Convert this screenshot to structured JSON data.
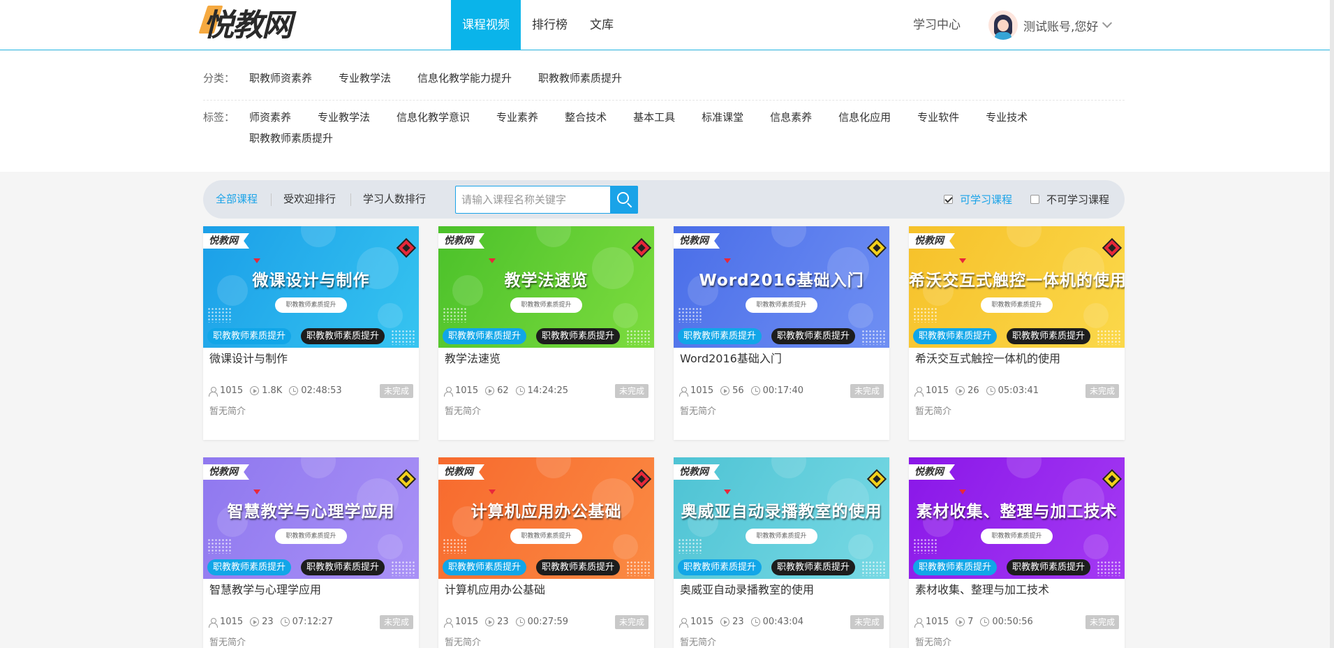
{
  "header": {
    "logo": "悦教网",
    "nav": [
      {
        "label": "课程视频",
        "active": true
      },
      {
        "label": "排行榜",
        "active": false
      },
      {
        "label": "文库",
        "active": false
      }
    ],
    "study_center": "学习中心",
    "user_name": "测试账号,您好"
  },
  "filters": {
    "category_label": "分类：",
    "categories": [
      "职教师资素养",
      "专业教学法",
      "信息化教学能力提升",
      "职教教师素质提升"
    ],
    "tag_label": "标签：",
    "tags": [
      "师资素养",
      "专业教学法",
      "信息化教学意识",
      "专业素养",
      "整合技术",
      "基本工具",
      "标准课堂",
      "信息素养",
      "信息化应用",
      "专业软件",
      "专业技术",
      "职教教师素质提升"
    ]
  },
  "toolbar": {
    "sort_all": "全部课程",
    "sort_popular": "受欢迎排行",
    "sort_learners": "学习人数排行",
    "search_placeholder": "请输入课程名称关键字",
    "filter_available": "可学习课程",
    "filter_unavailable": "不可学习课程"
  },
  "card_common": {
    "thumb_logo": "悦教网",
    "thumb_pill": "职教教师素质提升",
    "tag1": "职教教师素质提升",
    "tag2": "职教教师素质提升",
    "status": "未完成",
    "desc": "暂无简介"
  },
  "courses": [
    {
      "title": "微课设计与制作",
      "learners": "1015",
      "plays": "1.8K",
      "duration": "02:48:53",
      "color1": "#1b9fe8",
      "color2": "#36c4f0",
      "diamond": "#e8283a"
    },
    {
      "title": "教学法速览",
      "learners": "1015",
      "plays": "62",
      "duration": "14:24:25",
      "color1": "#4bc12a",
      "color2": "#7ddc3f",
      "diamond": "#e8283a"
    },
    {
      "title": "Word2016基础入门",
      "learners": "1015",
      "plays": "56",
      "duration": "00:17:40",
      "color1": "#4a6ee8",
      "color2": "#6f8ff3",
      "diamond": "#f4d11a"
    },
    {
      "title": "希沃交互式触控一体机的使用",
      "learners": "1015",
      "plays": "26",
      "duration": "05:03:41",
      "color1": "#f6c12a",
      "color2": "#fbd84a",
      "diamond": "#e8283a"
    },
    {
      "title": "智慧教学与心理学应用",
      "learners": "1015",
      "plays": "23",
      "duration": "07:12:27",
      "color1": "#8f78ef",
      "color2": "#a991f6",
      "diamond": "#f4d11a"
    },
    {
      "title": "计算机应用办公基础",
      "learners": "1015",
      "plays": "23",
      "duration": "00:27:59",
      "color1": "#f76a2e",
      "color2": "#fb8a43",
      "diamond": "#e8283a"
    },
    {
      "title": "奥威亚自动录播教室的使用",
      "learners": "1015",
      "plays": "23",
      "duration": "00:43:04",
      "color1": "#4ec3d4",
      "color2": "#78d9e4",
      "diamond": "#f4d11a"
    },
    {
      "title": "素材收集、整理与加工技术",
      "learners": "1015",
      "plays": "7",
      "duration": "00:50:56",
      "color1": "#8a17e8",
      "color2": "#a43af3",
      "diamond": "#f4d11a"
    }
  ]
}
